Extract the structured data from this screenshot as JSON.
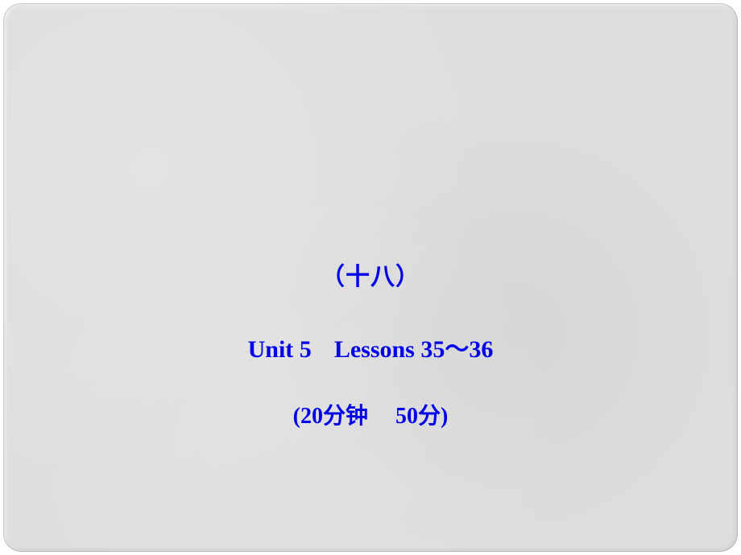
{
  "slide": {
    "chapter": "（十八）",
    "unit_line_prefix": "Unit 5",
    "unit_line_suffix": "Lessons 35～36",
    "time_line_prefix": "(20分钟",
    "time_line_suffix": "50分)"
  }
}
